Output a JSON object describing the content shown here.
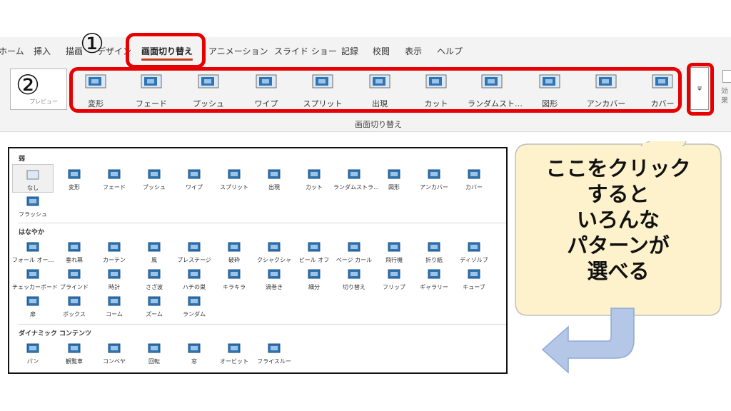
{
  "ribbon": {
    "tabs": [
      "ホーム",
      "挿入",
      "描画",
      "デザイン",
      "画面切り替え",
      "アニメーション",
      "スライド ショー",
      "記録",
      "校閲",
      "表示",
      "ヘルプ"
    ],
    "active_tab": "画面切り替え",
    "preview_label": "プレビュー",
    "gallery": [
      "変形",
      "フェード",
      "プッシュ",
      "ワイプ",
      "スプリット",
      "出現",
      "カット",
      "ランダムスト…",
      "図形",
      "アンカバー",
      "カバー"
    ],
    "group_label": "画面切り替え",
    "effect_label": "効果のオプション",
    "more_button_icon": "chevron-down-icon",
    "accent_color": "#c43e1c"
  },
  "annotations": {
    "step1": "①",
    "step2": "②",
    "highlight_color": "#e60000",
    "callout_lines": [
      "ここをクリック",
      "すると",
      "いろんな",
      "パターンが",
      "選べる"
    ],
    "callout_fill": "#fdf2cc",
    "arrow_fill": "#b4c7e7"
  },
  "gallery_panel": {
    "sections": [
      {
        "title": "弱",
        "items": [
          "なし",
          "変形",
          "フェード",
          "プッシュ",
          "ワイプ",
          "スプリット",
          "出現",
          "カット",
          "ランダムストラ…",
          "図形",
          "アンカバー",
          "カバー",
          "フラッシュ"
        ]
      },
      {
        "title": "はなやか",
        "items": [
          "フォール オー…",
          "垂れ幕",
          "カーテン",
          "風",
          "プレステージ",
          "破砕",
          "クシャクシャ",
          "ピール オフ",
          "ページ カール",
          "飛行機",
          "折り紙",
          "ディゾルブ",
          "チェッカーボード",
          "ブラインド",
          "時計",
          "さざ波",
          "ハチの巣",
          "キラキラ",
          "渦巻き",
          "細分",
          "切り替え",
          "フリップ",
          "ギャラリー",
          "キューブ",
          "扉",
          "ボックス",
          "コーム",
          "ズーム",
          "ランダム"
        ]
      },
      {
        "title": "ダイナミック コンテンツ",
        "items": [
          "パン",
          "観覧車",
          "コンベヤ",
          "回転",
          "窓",
          "オービット",
          "フライスルー"
        ]
      }
    ],
    "selected_item": "なし",
    "icon_color": "#2e75b6"
  }
}
